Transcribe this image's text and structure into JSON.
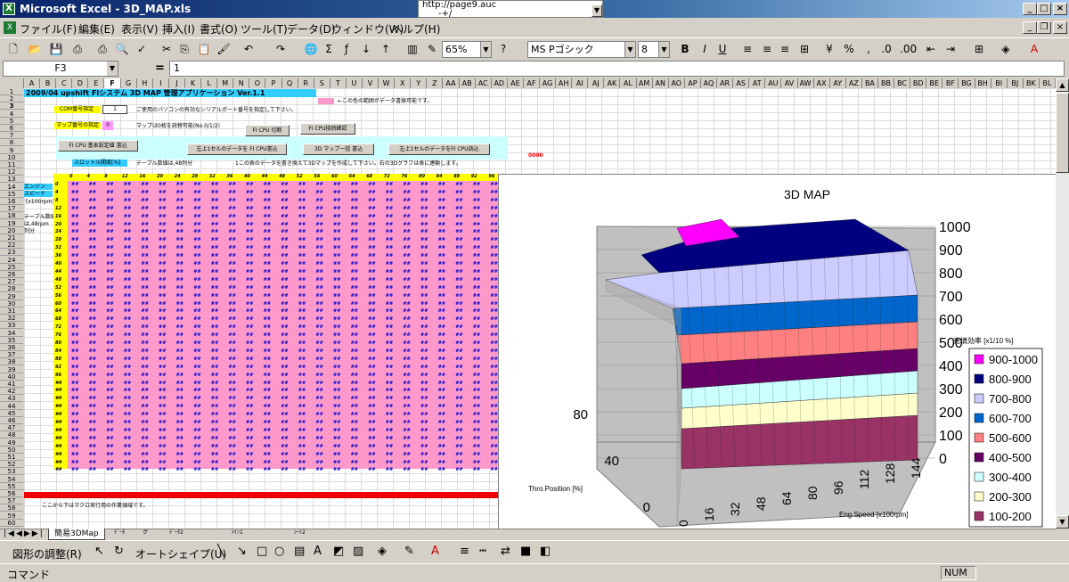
{
  "window": {
    "title": "Microsoft Excel - 3D_MAP.xls",
    "url": "http://page9.auc",
    "url_sub": "-+/"
  },
  "menu": [
    "ファイル(F)",
    "編集(E)",
    "表示(V)",
    "挿入(I)",
    "書式(O)",
    "ツール(T)",
    "データ(D)",
    "ウィンドウ(W)",
    "ヘルプ(H)"
  ],
  "toolbar": {
    "zoom": "65%",
    "font": "MS Pゴシック",
    "size": "8"
  },
  "formula": {
    "cell": "F3",
    "eq": "=",
    "value": "1"
  },
  "columns": [
    "A",
    "B",
    "C",
    "D",
    "E",
    "F",
    "G",
    "H",
    "I",
    "J",
    "K",
    "L",
    "M",
    "N",
    "O",
    "P",
    "Q",
    "R",
    "S",
    "T",
    "U",
    "V",
    "W",
    "X",
    "Y",
    "Z",
    "AA",
    "AB",
    "AC",
    "AD",
    "AE",
    "AF",
    "AG",
    "AH",
    "AI",
    "AJ",
    "AK",
    "AL",
    "AM",
    "AN",
    "AO",
    "AP",
    "AQ",
    "AR",
    "AS",
    "AT",
    "AU",
    "AV",
    "AW",
    "AX",
    "AY",
    "AZ",
    "BA",
    "BB",
    "BC",
    "BD",
    "BE",
    "BF",
    "BG",
    "BH",
    "BI",
    "BJ",
    "BK",
    "BL"
  ],
  "sheet": {
    "banner": "2009/04 upshift FIシステム 3D MAP 管理アプリケーション Ver.1.1",
    "pink_note": "←この色の範囲がデータ書換可能です。",
    "com_label": "COM番号指定",
    "com_value": "1",
    "com_note": "ご使用のパソコンの有効なシリアルポート番号を指定して下さい。",
    "map_label": "マップ番号の指定",
    "map_value": "0",
    "map_note": "マップは0枚を読替可能(No.0/1/2)",
    "btn_fi_switch": "FI CPU 切断",
    "btn_fi_confirm": "FI CPU接続確認",
    "btn_fi_basic": "FI CPU 基本設定値 書込",
    "btn_upper_left": "左上1セルのデータを FI CPU書込",
    "btn_3d_write": "3D マップ一括 書込",
    "btn_upper_left2": "左上1セルのデータをFI CPU読込",
    "red_value": "0000",
    "throttle_label": "スロットル開度[%]",
    "data_note": "テーブル数値は,48列分",
    "chart_note": "1この表のデータを書き換えて3Dマップを作成して下さい。右の3Dグラフは表に連動します。",
    "engine_label1": "エンジン",
    "engine_label2": "スピード",
    "engine_label3": "[x100rpm]",
    "table_label1": "テーブル数値",
    "table_label2": "は,48rpm",
    "table_label3": "列分",
    "col_headers": [
      "0",
      "4",
      "8",
      "12",
      "16",
      "20",
      "24",
      "28",
      "32",
      "36",
      "40",
      "44",
      "48",
      "52",
      "56",
      "60",
      "64",
      "68",
      "72",
      "76",
      "80",
      "84",
      "88",
      "92",
      "96",
      "##"
    ],
    "row_headers": [
      "0",
      "4",
      "8",
      "12",
      "16",
      "20",
      "24",
      "28",
      "32",
      "36",
      "40",
      "44",
      "48",
      "52",
      "56",
      "60",
      "64",
      "68",
      "72",
      "76",
      "80",
      "84",
      "88",
      "92",
      "96",
      "##",
      "##",
      "##",
      "##",
      "##",
      "##",
      "##",
      "##",
      "##",
      "##",
      "##",
      "##"
    ],
    "cell_value": "##",
    "macro_note": "ここから下はマクロ実行用の作業領域です。"
  },
  "chart_data": {
    "type": "surface",
    "title": "3D MAP",
    "zticks": [
      "0",
      "100",
      "200",
      "300",
      "400",
      "500",
      "600",
      "700",
      "800",
      "900",
      "1000"
    ],
    "xlabel": "Eng.Speed [x100rpm]",
    "ylabel": "Thro.Position [%]",
    "xticks": [
      "0",
      "16",
      "32",
      "48",
      "64",
      "80",
      "96",
      "112",
      "128",
      "144"
    ],
    "yticks": [
      "0",
      "40",
      "80"
    ],
    "legend_title": "充填効率 [x1/10 %]",
    "legend": [
      {
        "name": "900-1000",
        "color": "#ff00ff"
      },
      {
        "name": "800-900",
        "color": "#000080"
      },
      {
        "name": "700-800",
        "color": "#ccccff"
      },
      {
        "name": "600-700",
        "color": "#0066cc"
      },
      {
        "name": "500-600",
        "color": "#ff8080"
      },
      {
        "name": "400-500",
        "color": "#660066"
      },
      {
        "name": "300-400",
        "color": "#ccffff"
      },
      {
        "name": "200-300",
        "color": "#ffffcc"
      },
      {
        "name": "100-200",
        "color": "#993366"
      }
    ]
  },
  "tabs": {
    "active": "簡易3DMap",
    "others": [
      "ﾃﾞｰﾀ",
      "グ",
      "ﾃﾞｰﾀ2",
      "ﾒｲﾝ1",
      "ｼｰﾄ2"
    ]
  },
  "drawbar": {
    "adjust": "図形の調整(R)",
    "autoshape": "オートシェイプ(U)"
  },
  "status": {
    "left": "コマンド",
    "num": "NUM"
  }
}
